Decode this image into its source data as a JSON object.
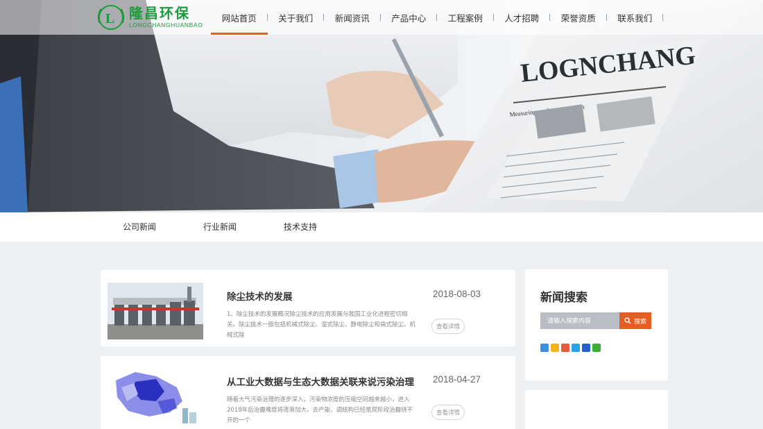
{
  "brand": {
    "name_cn": "隆昌环保",
    "name_en": "LONGCHANGHUANBAO",
    "color": "#1c9a3c"
  },
  "nav": {
    "items": [
      {
        "label": "网站首页",
        "active": true
      },
      {
        "label": "关于我们"
      },
      {
        "label": "新闻资讯"
      },
      {
        "label": "产品中心"
      },
      {
        "label": "工程案例"
      },
      {
        "label": "人才招聘"
      },
      {
        "label": "荣誉资质"
      },
      {
        "label": "联系我们"
      }
    ],
    "accent": "#e65c23"
  },
  "hero": {
    "newspaper_headline": "LOGNCHANG",
    "newspaper_subline": "Measuring market penetration"
  },
  "subnav": {
    "items": [
      "公司新闻",
      "行业新闻",
      "技术支持"
    ]
  },
  "news": [
    {
      "title": "除尘技术的发展",
      "date": "2018-08-03",
      "desc": "1、除尘技术的发展概况除尘技术的应用发展与我国工业化进程密切相关。除尘技术一般包括机械式除尘、湿式除尘、静电除尘和袋式除尘。机械式除",
      "button": "查看详情"
    },
    {
      "title": "从工业大数据与生态大数据关联来说污染治理",
      "date": "2018-04-27",
      "desc": "随着大气污染治理的逐步深入，污染物浓度的压缩空间越来越小，进入2018年后治霾难度将逐渐加大。去产能、调结构已经是现阶段治霾绕不开的一个",
      "button": "查看详情"
    }
  ],
  "sidebar": {
    "search_title": "新闻搜索",
    "search_placeholder": "请输入搜索内容",
    "search_button": "搜索",
    "share_icons": [
      "qzone-icon",
      "renren-icon",
      "weibo-icon",
      "tencent-weibo-icon",
      "baidu-icon",
      "wechat-icon"
    ]
  }
}
